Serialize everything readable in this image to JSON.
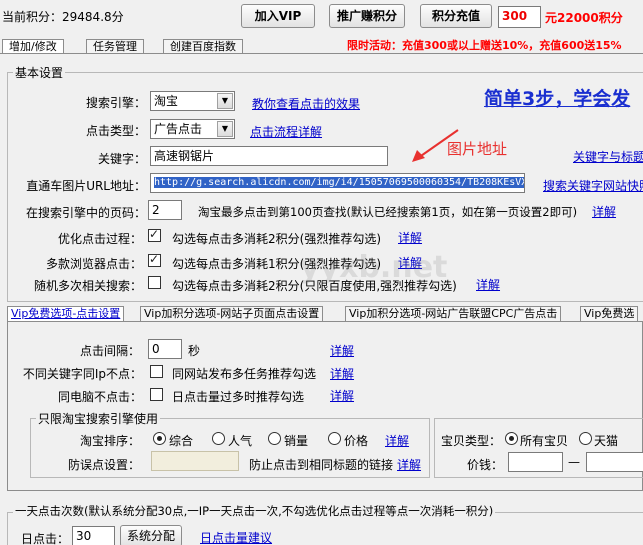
{
  "topbar": {
    "score_label": "当前积分：",
    "score_value": "29484.8分",
    "join_vip": "加入VIP",
    "promote": "推广赚积分",
    "recharge": "积分充值",
    "recharge_amount": "300",
    "recharge_result": "元22000积分",
    "promo_text": "限时活动：充值300或以上赠送10%，充值600送15%"
  },
  "tabs": [
    "增加/修改",
    "任务管理",
    "创建百度指数"
  ],
  "basic": {
    "title": "基本设置",
    "engine_label": "搜索引擎：",
    "engine_value": "淘宝",
    "engine_link": "教你查看点击的效果",
    "headline": "简单3步，学会发",
    "click_type_label": "点击类型：",
    "click_type_value": "广告点击",
    "click_flow_link": "点击流程详解",
    "keyword_label": "关键字：",
    "keyword_value": "高速钢锯片",
    "keyword_title_link": "关键字与标题",
    "annotation": "图片地址",
    "url_label": "直通车图片URL地址：",
    "url_value": "http://g.search.alicdn.com/img/i4/150570695000603​54/TB208KEsVX",
    "url_link": "搜索关键字网站快照",
    "page_label": "在搜索引擎中的页码：",
    "page_value": "2",
    "page_hint": "淘宝最多点击到第100页查找(默认已经搜索第1页，如在第一页设置2即可)",
    "page_link": "详解",
    "opt_label": "优化点击过程：",
    "opt_text": "勾选每点击多消耗2积分(强烈推荐勾选)",
    "opt_link": "详解",
    "multi_label": "多款浏览器点击：",
    "multi_text": "勾选每点击多消耗1积分(强烈推荐勾选)",
    "multi_link": "详解",
    "random_label": "随机多次相关搜索：",
    "random_text": "勾选每点击多消耗2积分(只限百度使用,强烈推荐勾选)",
    "random_link": "详解"
  },
  "subtabs": [
    "Vip免费选项-点击设置",
    "Vip加积分选项-网站子页面点击设置",
    "Vip加积分选项-网站广告联盟CPC广告点击",
    "Vip免费选"
  ],
  "vip": {
    "interval_label": "点击间隔：",
    "interval_value": "0",
    "interval_unit": "秒",
    "interval_link": "详解",
    "ip_label": "不同关键字同Ip不点：",
    "ip_text": "同网站发布多任务推荐勾选",
    "ip_link": "详解",
    "pc_label": "同电脑不点击：",
    "pc_text": "日点击量过多时推荐勾选",
    "pc_link": "详解",
    "taobao_group": "只限淘宝搜索引擎使用",
    "sort_label": "淘宝排序：",
    "sort_options": [
      "综合",
      "人气",
      "销量",
      "价格"
    ],
    "sort_link": "详解",
    "misclick_label": "防误点设置：",
    "misclick_text": "防止点击到相同标题的链接",
    "misclick_link": "详解",
    "type_label": "宝贝类型：",
    "type_options": [
      "所有宝贝",
      "天猫"
    ],
    "price_label": "价钱：",
    "price_sep": "—"
  },
  "daily": {
    "title": "一天点击次数(默认系统分配30点,一IP一天点击一次,不勾选优化点击过程等点一次消耗一积分)",
    "label": "日点击：",
    "value": "30",
    "button": "系统分配",
    "link": "日点击量建议"
  },
  "watermark": "yyxb.net",
  "colors": {
    "link": "#0000cc",
    "promo": "#ff0000",
    "annotation": "#e8312f",
    "headline": "#1a2fd0"
  }
}
